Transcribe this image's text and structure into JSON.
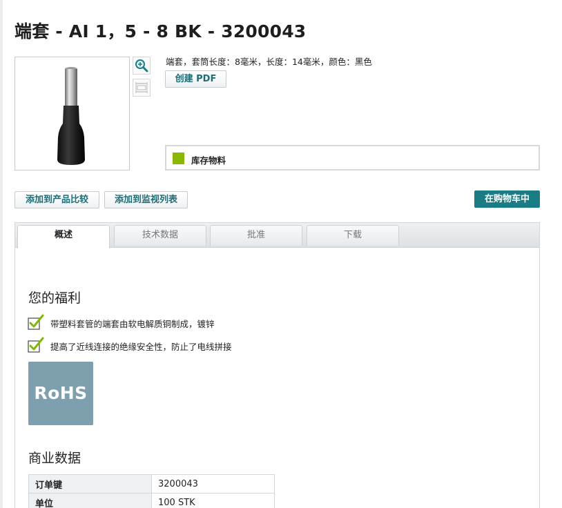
{
  "page_title": "端套 - AI 1，5 - 8 BK - 3200043",
  "product": {
    "description": "端套，套筒长度：8毫米，长度：14毫米，颜色：黑色",
    "image_alt": "端套产品图片"
  },
  "image_tools": {
    "zoom_icon": "zoom-in-icon",
    "dimension_icon": "dimension-drawing-icon"
  },
  "buttons": {
    "create_pdf": "创建 PDF",
    "add_compare": "添加到产品比较",
    "add_watchlist": "添加到监视列表",
    "add_cart": "在购物车中"
  },
  "stock": {
    "label": "库存物料",
    "color": "#8ab800"
  },
  "tabs": [
    {
      "label": "概述",
      "active": true
    },
    {
      "label": "技术数据",
      "active": false
    },
    {
      "label": "批准",
      "active": false
    },
    {
      "label": "下载",
      "active": false
    }
  ],
  "benefits": {
    "heading": "您的福利",
    "items": [
      "带塑料套管的端套由软电解质铜制成，镀锌",
      "提高了近线连接的绝缘安全性，防止了电线拼接"
    ]
  },
  "rohs_label": "RoHS",
  "commercial": {
    "heading": "商业数据",
    "rows": [
      {
        "key": "订单键",
        "value": "3200043"
      },
      {
        "key": "单位",
        "value": "100 STK"
      }
    ]
  },
  "colors": {
    "accent": "#1a7d86",
    "link_text": "#1a6e78",
    "rohs_bg": "#7e9fad"
  }
}
